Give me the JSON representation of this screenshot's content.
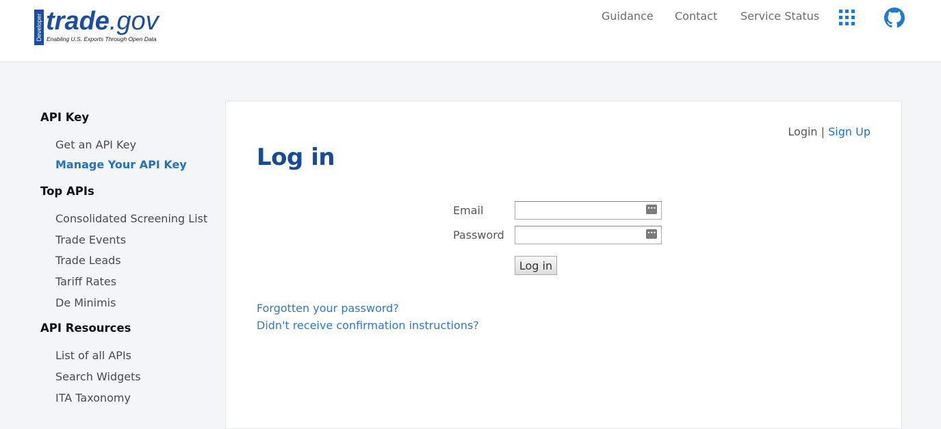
{
  "brand": {
    "badge_text": "Developer",
    "name_bold": "trade",
    "name_rest": ".gov",
    "tagline": "Enabling U.S. Exports Through Open Data",
    "color": "#1b4ea0"
  },
  "topnav": {
    "items": [
      {
        "label": "Guidance"
      },
      {
        "label": "Contact"
      },
      {
        "label": "Service Status"
      }
    ],
    "apps_icon": "grid-icon",
    "github_icon": "github-icon",
    "accent": "#1b7ad4"
  },
  "sidebar": {
    "sections": [
      {
        "heading": "API Key",
        "links": [
          {
            "label": "Get an API Key",
            "active": false
          },
          {
            "label": "Manage Your API Key",
            "active": true
          }
        ]
      },
      {
        "heading": "Top APIs",
        "links": [
          {
            "label": "Consolidated Screening List"
          },
          {
            "label": "Trade Events"
          },
          {
            "label": "Trade Leads"
          },
          {
            "label": "Tariff Rates"
          },
          {
            "label": "De Minimis"
          }
        ]
      },
      {
        "heading": "API Resources",
        "links": [
          {
            "label": "List of all APIs"
          },
          {
            "label": "Search Widgets"
          },
          {
            "label": "ITA Taxonomy"
          }
        ]
      }
    ]
  },
  "main": {
    "auth": {
      "login": "Login",
      "separator": "|",
      "signup": "Sign Up"
    },
    "title": "Log in",
    "form": {
      "email_label": "Email",
      "email_value": "",
      "password_label": "Password",
      "password_value": "",
      "submit_label": "Log in"
    },
    "links": {
      "forgot_password": "Forgotten your password?",
      "no_confirmation": "Didn't receive confirmation instructions?"
    },
    "title_color": "#184b95",
    "link_color": "#1f72c4"
  }
}
